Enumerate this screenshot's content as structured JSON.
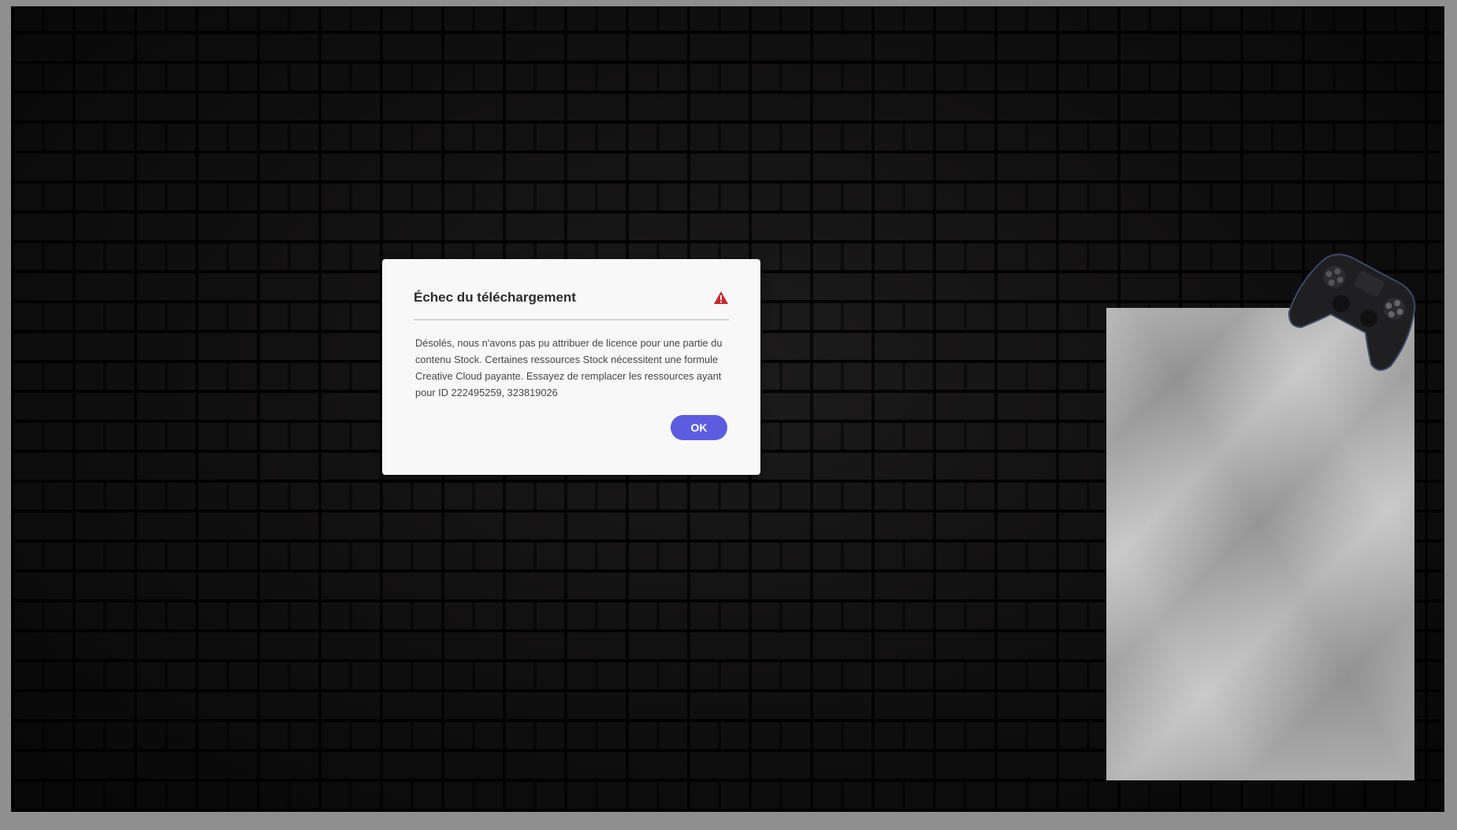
{
  "dialog": {
    "title": "Échec du téléchargement",
    "message": "Désolés, nous n'avons pas pu attribuer de licence pour une partie du contenu Stock. Certaines ressources Stock nécessitent une formule Creative Cloud payante. Essayez de remplacer les ressources ayant pour ID 222495259, 323819026",
    "ok_label": "OK",
    "icon": "warning-icon"
  },
  "colors": {
    "accent": "#5c5ce0",
    "warning": "#c9252d",
    "dialog_background": "#f8f8f8",
    "workspace_background": "#8f8f8f"
  }
}
